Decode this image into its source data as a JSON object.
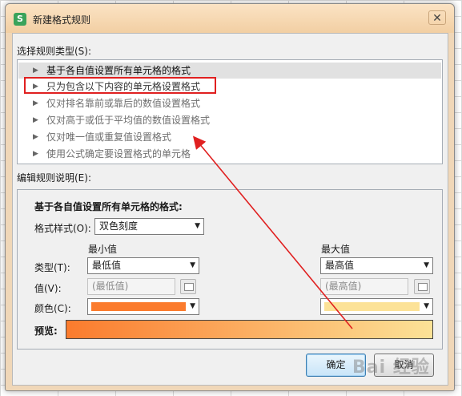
{
  "dialog": {
    "title": "新建格式规则",
    "app_icon": "S",
    "close_icon": "close-x-icon"
  },
  "rule_type": {
    "heading": "选择规则类型(S):",
    "items": [
      "基于各自值设置所有单元格的格式",
      "只为包含以下内容的单元格设置格式",
      "仅对排名靠前或靠后的数值设置格式",
      "仅对高于或低于平均值的数值设置格式",
      "仅对唯一值或重复值设置格式",
      "使用公式确定要设置格式的单元格"
    ],
    "selected_index": 0,
    "highlighted_index": 1
  },
  "edit_rule": {
    "heading": "编辑规则说明(E):",
    "section_title": "基于各自值设置所有单元格的格式:",
    "format_style_label": "格式样式(O):",
    "format_style_value": "双色刻度",
    "min_header": "最小值",
    "max_header": "最大值",
    "type_label": "类型(T):",
    "value_label": "值(V):",
    "color_label": "颜色(C):",
    "min_type": "最低值",
    "max_type": "最高值",
    "min_value": "(最低值)",
    "max_value": "(最高值)",
    "min_color": "#fb7b2d",
    "max_color": "#fce297",
    "preview_label": "预览:"
  },
  "buttons": {
    "ok": "确定",
    "cancel": "取消"
  },
  "annotation": {
    "arrow_color": "#e02020",
    "watermark": "Bai 经验"
  }
}
